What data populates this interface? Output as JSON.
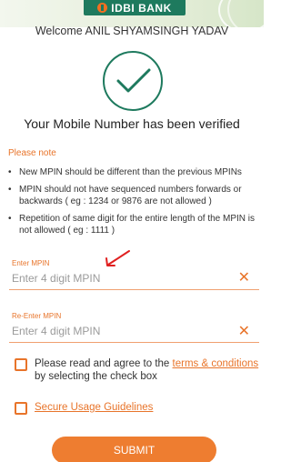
{
  "header": {
    "logo_text": "IDBI BANK",
    "welcome": "Welcome ANIL SHYAMSINGH YADAV"
  },
  "status": {
    "message": "Your Mobile Number has been verified"
  },
  "note": {
    "title": "Please note",
    "items": [
      "New MPIN should be different than the previous MPINs",
      "MPIN should not have sequenced numbers forwards or backwards ( eg : 1234 or 9876 are not allowed )",
      "Repetition of same digit for the entire length of the MPIN is not allowed ( eg : 1111 )"
    ]
  },
  "form": {
    "mpin_label": "Enter MPIN",
    "mpin_placeholder": "Enter 4 digit MPIN",
    "mpin_value": "",
    "reenter_label": "Re-Enter MPIN",
    "reenter_placeholder": "Enter 4 digit MPIN",
    "reenter_value": "",
    "terms_prefix": "Please read and agree to the ",
    "terms_link": "terms & conditions",
    "terms_suffix": " by selecting the check box",
    "guidelines_link": "Secure Usage Guidelines",
    "submit_label": "SUBMIT"
  },
  "colors": {
    "accent": "#e8742a",
    "brand_green": "#1e7a5e",
    "button": "#ee7d30"
  }
}
